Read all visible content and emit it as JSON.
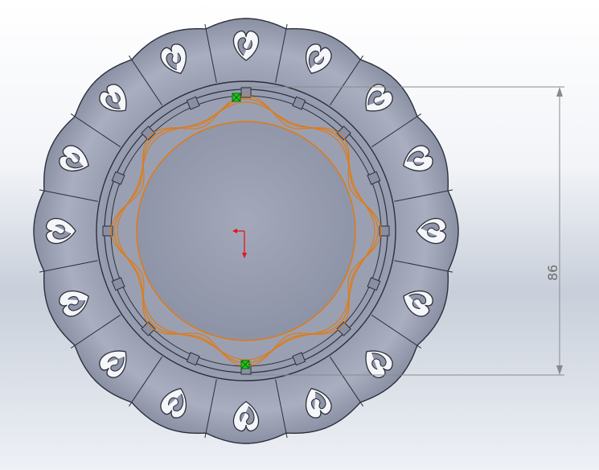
{
  "viewport": {
    "background_top": "#ffffff",
    "background_bottom": "#c8cfda"
  },
  "model": {
    "body_color": "#9ba1b3",
    "rim_color": "#a6acbd",
    "edge_color": "#2d2f3a",
    "sketch_color": "#e07a12",
    "point_color": "#22c622",
    "origin_color": "#e01818",
    "petal_count": 16,
    "star_points": 8
  },
  "dimension": {
    "value": "86",
    "line_color": "#8a8a8a"
  }
}
